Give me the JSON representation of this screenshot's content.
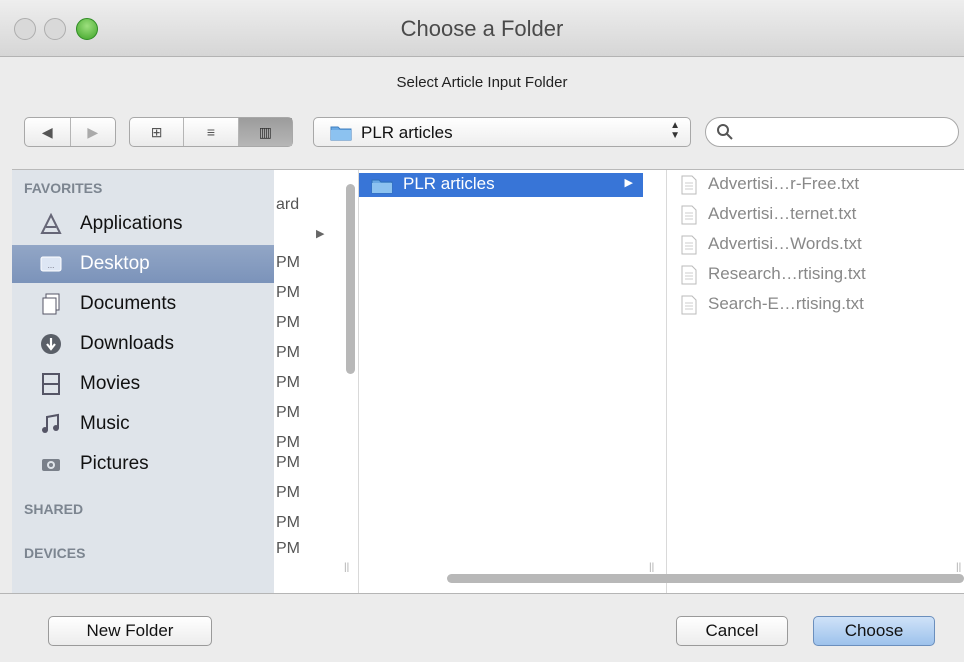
{
  "window": {
    "title": "Choose a Folder"
  },
  "dialog": {
    "message": "Select Article Input Folder"
  },
  "toolbar": {
    "nav": {
      "back": "◀",
      "forward": "▶"
    },
    "views": [
      {
        "name": "icon-view",
        "symbol": "⊞"
      },
      {
        "name": "list-view",
        "symbol": "≡"
      },
      {
        "name": "column-view",
        "symbol": "▥",
        "active": true
      }
    ],
    "location_popup": {
      "selected": "PLR articles",
      "arrows": "▲▼"
    },
    "search": {
      "placeholder": ""
    }
  },
  "sidebar": {
    "sections": {
      "favorites": "FAVORITES",
      "shared": "SHARED",
      "devices": "DEVICES"
    },
    "items": [
      {
        "label": "Applications",
        "icon": "applications-icon"
      },
      {
        "label": "Desktop",
        "icon": "desktop-icon",
        "selected": true
      },
      {
        "label": "Documents",
        "icon": "documents-icon"
      },
      {
        "label": "Downloads",
        "icon": "downloads-icon"
      },
      {
        "label": "Movies",
        "icon": "movies-icon"
      },
      {
        "label": "Music",
        "icon": "music-icon"
      },
      {
        "label": "Pictures",
        "icon": "pictures-icon"
      }
    ]
  },
  "columns": {
    "col1_partial": [
      "ard",
      "▶",
      "PM",
      "PM",
      "PM",
      "PM",
      "PM",
      "PM",
      "PM",
      "PM",
      "PM",
      "PM",
      "PM"
    ],
    "col2": {
      "selected_folder": "PLR articles",
      "arrow": "▶"
    },
    "col3_files": [
      "Advertisi…r-Free.txt",
      "Advertisi…ternet.txt",
      "Advertisi…Words.txt",
      "Research…rtising.txt",
      "Search-E…rtising.txt"
    ]
  },
  "buttons": {
    "new_folder": "New Folder",
    "cancel": "Cancel",
    "choose": "Choose"
  },
  "colors": {
    "selection": "#3875d7",
    "sidebar_bg": "#dfe4ea",
    "sidebar_selected": "#7b93ba"
  }
}
